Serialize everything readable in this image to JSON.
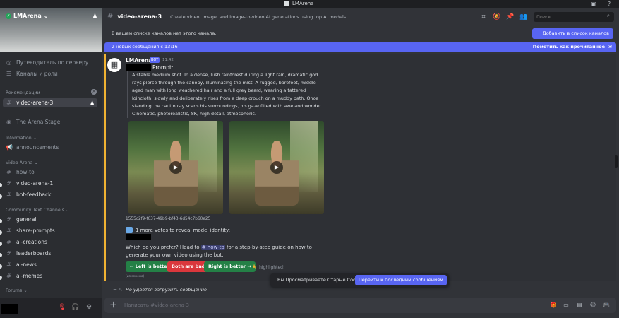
{
  "window": {
    "title": "LMArena"
  },
  "server": {
    "name": "LMArena"
  },
  "sidebar": {
    "top_items": [
      {
        "label": "Путеводитель по серверу",
        "icon": "compass-icon"
      },
      {
        "label": "Каналы и роли",
        "icon": "list-icon"
      }
    ],
    "recommended_label": "Рекомендации",
    "recommended_channel": "video-arena-3",
    "stage": "The Arena Stage",
    "cat_information": "Information",
    "announcements": "announcements",
    "cat_video_arena": "Video Arena",
    "video_channels": [
      "how-to",
      "video-arena-1",
      "bot-feedback"
    ],
    "cat_community": "Community Text Channels",
    "community_channels": [
      "general",
      "share-prompts",
      "ai-creations",
      "leaderboards",
      "ai-news",
      "ai-memes"
    ],
    "cat_forums": "Forums"
  },
  "header": {
    "channel": "video-arena-3",
    "topic": "Create video, image, and image-to-video AI generations using top AI models.",
    "search_placeholder": "Поиск"
  },
  "notice": {
    "text": "В вашем списке каналов нет этого канала.",
    "button": "Добавить в список каналов"
  },
  "new_messages": {
    "text": "2 новых сообщения с 13:16",
    "mark_read": "Пометить как прочитанное"
  },
  "message": {
    "author": "LMArena",
    "bot_tag": "BOT",
    "time": "11:42",
    "prompt_label": "Prompt:",
    "prompt_text": "A stable medium shot. In a dense, lush rainforest during a light rain, dramatic god rays pierce through the canopy, illuminating the mist. A rugged, barefoot, middle-aged man with long weathered hair and a full grey beard, wearing a tattered loincloth, slowly and deliberately rises from a deep crouch on a muddy path. Once standing, he cautiously scans his surroundings, his gaze filled with awe and wonder. Cinematic, photorealistic, 8K, high detail, atmospheric.",
    "uuid": "1555c2f9-f637-49b9-bf43-6d54c7b60e25",
    "reveal_text": "1 more votes to reveal model identity:",
    "prefer_before": "Which do you prefer? Head to ",
    "prefer_mention": "# how-to",
    "prefer_after": " for a step-by-step guide on how to generate your own video using the bot.",
    "buttons": {
      "left": "← Left is better",
      "both_bad": "Both are bad",
      "right": "Right is better →"
    },
    "highlighted": "highlighted!",
    "edited": "(изменено)"
  },
  "failed_load": "Не удается загрузить сообщение",
  "old_messages": {
    "text": "Вы Просматриваете Старые Сообщения",
    "jump": "Перейти к последним сообщениям"
  },
  "composer": {
    "placeholder": "Написать #video-arena-3"
  },
  "colors": {
    "accent": "#5865f2",
    "green": "#248046",
    "red": "#da373c",
    "highlight_bar": "#f0b232"
  }
}
